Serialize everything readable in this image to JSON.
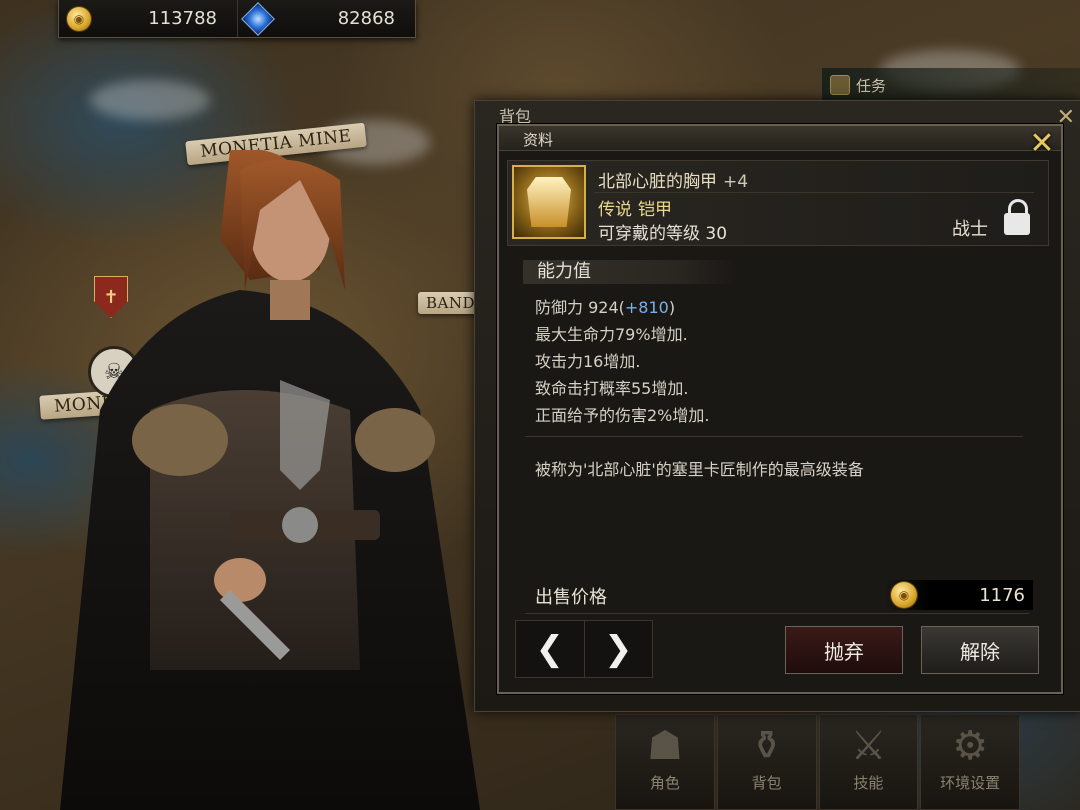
{
  "resources": {
    "gold": {
      "icon": "gold-coin-icon",
      "value": "113788"
    },
    "gem": {
      "icon": "blue-gem-icon",
      "value": "82868"
    }
  },
  "map": {
    "labels": [
      "MONETIA MINE",
      "MONETI",
      "BAND"
    ]
  },
  "quest_tab": {
    "label": "任务"
  },
  "bottom_menu": [
    {
      "label": "角色",
      "icon": "character-icon"
    },
    {
      "label": "背包",
      "icon": "bag-icon"
    },
    {
      "label": "技能",
      "icon": "skill-icon"
    },
    {
      "label": "环境设置",
      "icon": "gear-icon"
    }
  ],
  "bag_window": {
    "title": "背包"
  },
  "info_panel": {
    "title": "资料",
    "item": {
      "name": "北部心脏的胸甲",
      "enhance": "+4",
      "rarity": "传说",
      "type": "铠甲",
      "required_level": "可穿戴的等级 30",
      "class": "战士",
      "locked": true
    },
    "stats_title": "能力值",
    "stats": {
      "defense_label": "防御力 924(",
      "defense_bonus": "+810",
      "defense_close": ")",
      "lines": [
        "最大生命力79%增加.",
        "攻击力16增加.",
        "致命击打概率55增加.",
        "正面给予的伤害2%增加."
      ]
    },
    "description": "被称为'北部心脏'的塞里卡匠制作的最高级装备",
    "sell": {
      "label": "出售价格",
      "price": "1176"
    },
    "buttons": {
      "prev": "❮",
      "next": "❯",
      "discard": "抛弃",
      "dismantle": "解除"
    }
  },
  "colors": {
    "gold": "#e8c860",
    "stat_bonus": "#7ab0e8",
    "rarity": "#e8d890",
    "discard_bg": "#3a1a18"
  }
}
